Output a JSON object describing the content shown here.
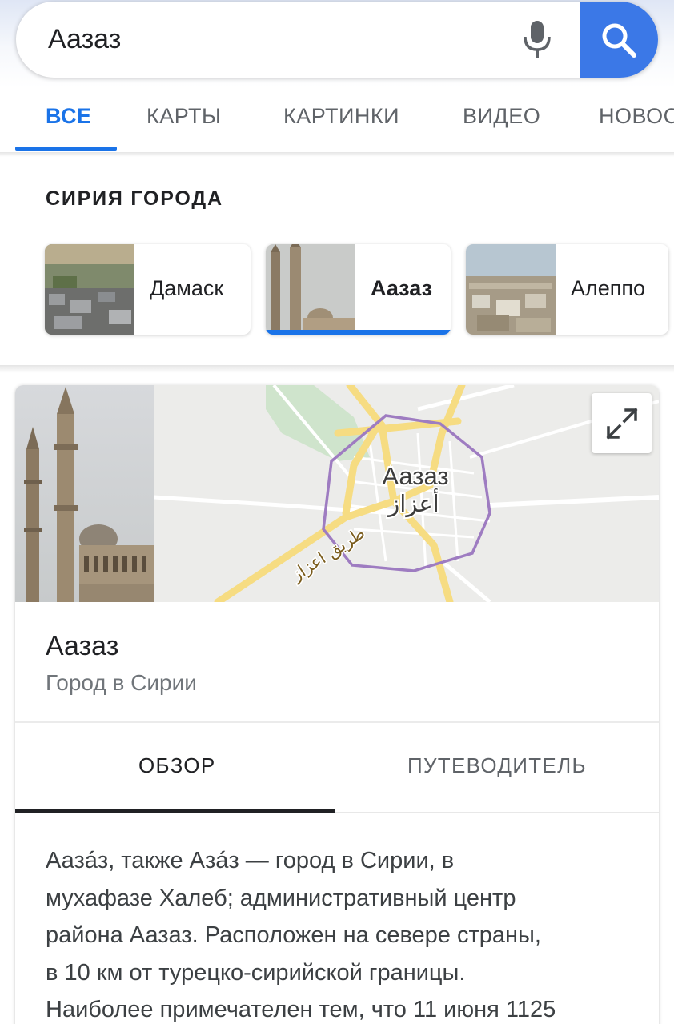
{
  "search": {
    "query": "Аазаз"
  },
  "tabs": [
    {
      "label": "ВСЕ",
      "active": true
    },
    {
      "label": "КАРТЫ",
      "active": false
    },
    {
      "label": "КАРТИНКИ",
      "active": false
    },
    {
      "label": "ВИДЕО",
      "active": false
    },
    {
      "label": "НОВОС",
      "active": false
    }
  ],
  "cities": {
    "title": "СИРИЯ ГОРОДА",
    "items": [
      {
        "name": "Дамаск",
        "selected": false
      },
      {
        "name": "Аазаз",
        "selected": true
      },
      {
        "name": "Алеппо",
        "selected": false
      }
    ]
  },
  "map": {
    "label_ru": "Аазаз",
    "label_ar": "أعزاز",
    "road_label": "طريق اعزاز"
  },
  "knowledge_panel": {
    "title": "Аазаз",
    "subtitle": "Город в Сирии",
    "tabs": [
      {
        "label": "ОБЗОР",
        "active": true
      },
      {
        "label": "ПУТЕВОДИТЕЛЬ",
        "active": false
      }
    ],
    "description_lines": [
      "Аазá́з, также Азá́з — город в Сирии, в",
      "мухафазе Халеб; административный центр",
      "района Аазаз. Расположен на севере страны,",
      "в 10 км от турецко-сирийской границы.",
      "Наиболее примечателен тем, что 11 июня 1125"
    ]
  },
  "colors": {
    "accent": "#1a73e8",
    "search_button": "#3b78e7",
    "map_boundary": "#9e7cc1",
    "map_road": "#f6dc82"
  },
  "icons": {
    "mic": "microphone-icon",
    "search": "search-icon",
    "expand": "expand-icon"
  }
}
